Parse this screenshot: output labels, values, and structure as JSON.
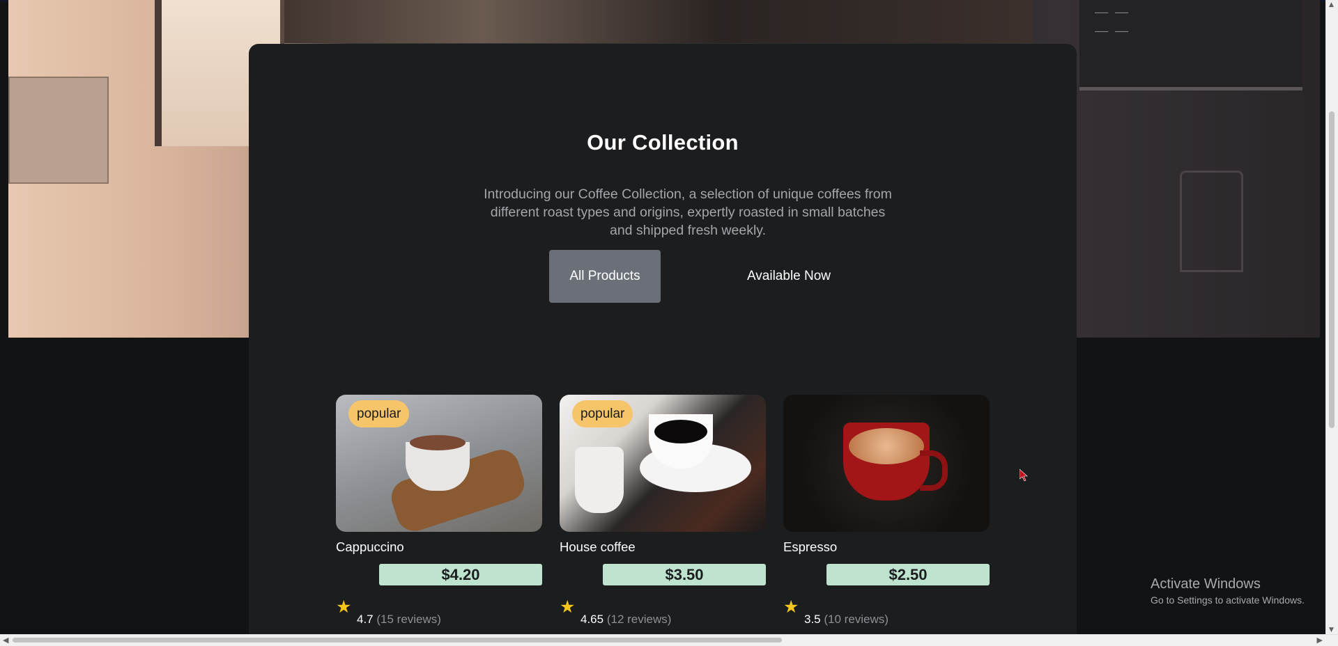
{
  "collection": {
    "title": "Our Collection",
    "intro": "Introducing our Coffee Collection, a selection of unique coffees from different roast types and origins, expertly roasted in small batches and shipped fresh weekly.",
    "filters": [
      {
        "label": "All Products",
        "active": true
      },
      {
        "label": "Available Now",
        "active": false
      }
    ]
  },
  "products": [
    {
      "name": "Cappuccino",
      "price": "$4.20",
      "badge": "popular",
      "rating": "4.7",
      "reviews": "(15 reviews)"
    },
    {
      "name": "House coffee",
      "price": "$3.50",
      "badge": "popular",
      "rating": "4.65",
      "reviews": "(12 reviews)"
    },
    {
      "name": "Espresso",
      "price": "$2.50",
      "badge": "",
      "rating": "3.5",
      "reviews": "(10 reviews)"
    }
  ],
  "overlay": {
    "activate_title": "Activate Windows",
    "activate_sub": "Go to Settings to activate Windows."
  },
  "colors": {
    "card_bg": "#1b1d1f",
    "badge": "#f6c56a",
    "price_bg": "#bee3cf",
    "active_filter": "#6b7078",
    "star": "#f5c518"
  }
}
